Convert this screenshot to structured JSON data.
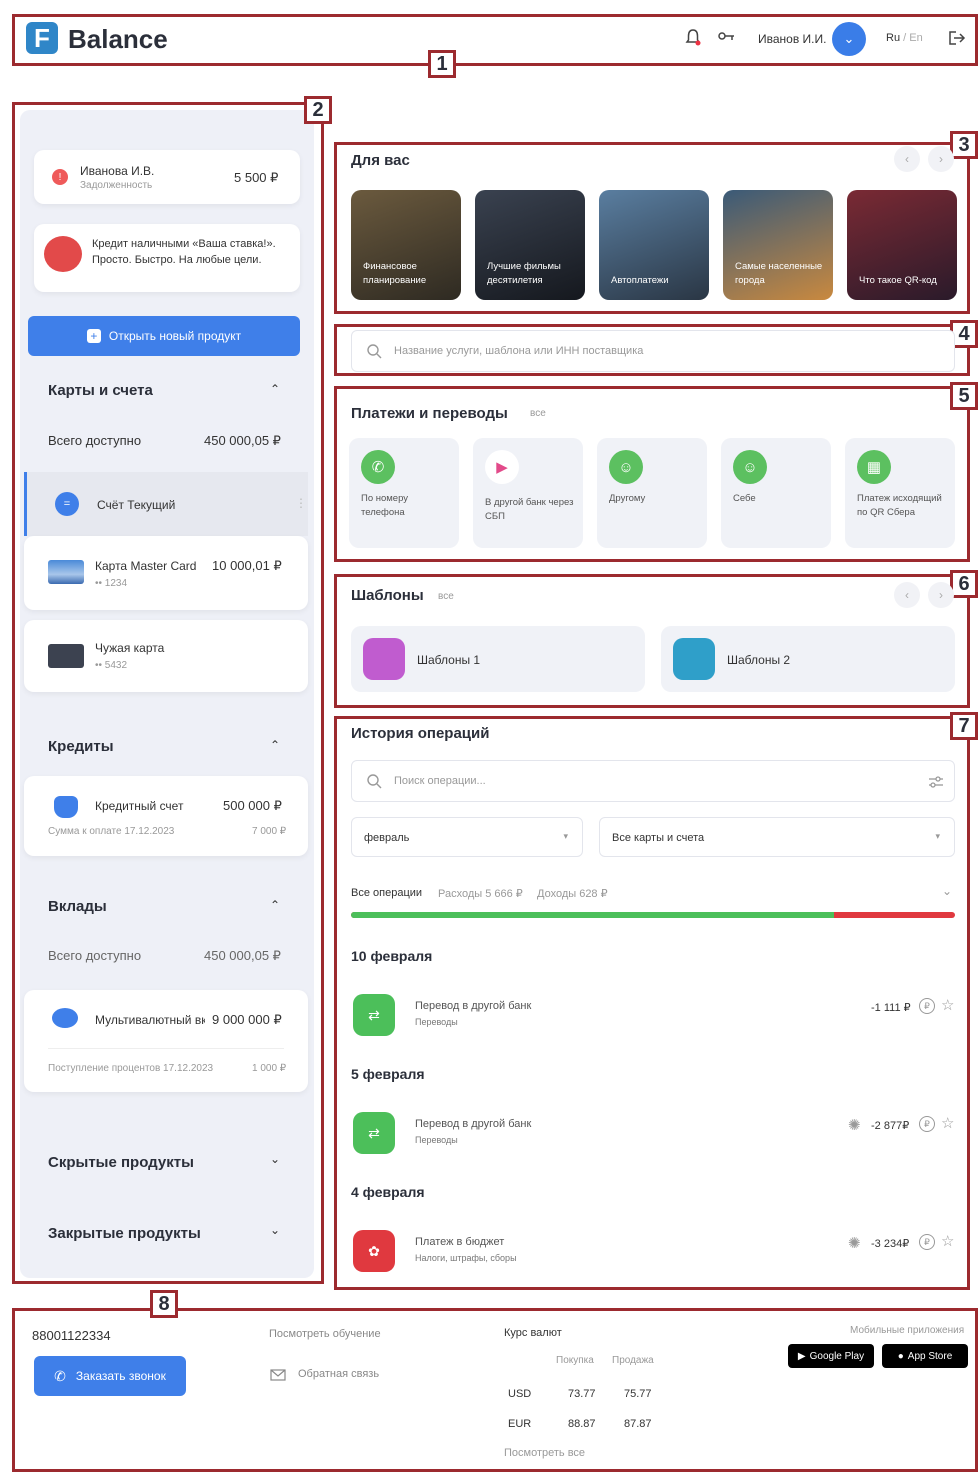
{
  "header": {
    "logo_letter": "F",
    "brand": "Balance",
    "user_name": "Иванов И.И.",
    "lang_ru": "Ru",
    "lang_sep": " / ",
    "lang_en": "En"
  },
  "tags": [
    "1",
    "2",
    "3",
    "4",
    "5",
    "6",
    "7",
    "8"
  ],
  "sidebar": {
    "debt": {
      "name": "Иванова И.В.",
      "sub": "Задолженность",
      "amount": "5 500 ₽"
    },
    "promo": {
      "text": "Кредит наличными «Ваша ставка!». Просто. Быстро. На любые цели."
    },
    "open_product": "Открыть новый продукт",
    "cards_section": {
      "title": "Карты и счета",
      "total_label": "Всего доступно",
      "total_value": "450 000,05 ₽",
      "items": [
        {
          "name": "Счёт Текущий",
          "amount": "",
          "sub": ""
        },
        {
          "name": "Карта Master Card",
          "amount": "10 000,01 ₽",
          "sub": "•• 1234"
        },
        {
          "name": "Чужая карта",
          "amount": "",
          "sub": "•• 5432"
        }
      ]
    },
    "credits_section": {
      "title": "Кредиты",
      "item_name": "Кредитный счет",
      "item_amount": "500 000 ₽",
      "item_sub": "Сумма к оплате 17.12.2023",
      "item_sub_amount": "7 000 ₽"
    },
    "deposits_section": {
      "title": "Вклады",
      "total_label": "Всего доступно",
      "total_value": "450 000,05 ₽",
      "item_name": "Мультивалютный вк",
      "item_amount": "9 000 000 ₽",
      "item_sub": "Поступление процентов 17.12.2023",
      "item_sub_amount": "1 000 ₽"
    },
    "hidden_products": "Скрытые продукты",
    "closed_products": "Закрытые продукты"
  },
  "for_you": {
    "title": "Для вас",
    "stories": [
      {
        "label": "Финансовое планирование",
        "color1": "#6b5a3e",
        "color2": "#2e2a22"
      },
      {
        "label": "Лучшие фильмы десятилетия",
        "color1": "#3a4250",
        "color2": "#15181e"
      },
      {
        "label": "Автоплатежи",
        "color1": "#5a7ea0",
        "color2": "#2a3644"
      },
      {
        "label": "Самые населенные города",
        "color1": "#3a5a78",
        "color2": "#c9893f"
      },
      {
        "label": "Что такое QR-код",
        "color1": "#7a2a34",
        "color2": "#2a1a2a"
      }
    ]
  },
  "search": {
    "placeholder": "Название услуги, шаблона или ИНН поставщика"
  },
  "payments": {
    "title": "Платежи и переводы",
    "all": "все",
    "tiles": [
      {
        "label": "По номеру телефона",
        "icon": "phone-icon"
      },
      {
        "label": "В другой банк через СБП",
        "icon": "sbp-icon"
      },
      {
        "label": "Другому",
        "icon": "person-add-icon"
      },
      {
        "label": "Себе",
        "icon": "person-icon"
      },
      {
        "label": "Платеж исходящий по QR Сбера",
        "icon": "qr-icon"
      }
    ]
  },
  "templates": {
    "title": "Шаблоны",
    "all": "все",
    "items": [
      {
        "label": "Шаблоны 1",
        "color": "#c05ccf"
      },
      {
        "label": "Шаблоны 2",
        "color": "#2f9fc9"
      }
    ]
  },
  "history": {
    "title": "История операций",
    "search_placeholder": "Поиск операции...",
    "month": "февраль",
    "accounts": "Все карты и счета",
    "filter_all": "Все операции",
    "filter_expenses": "Расходы 5 666 ₽",
    "filter_income": "Доходы 628 ₽",
    "income_share": 0.8,
    "groups": [
      {
        "date": "10 февраля",
        "name": "Перевод в другой банк",
        "category": "Переводы",
        "amount": "-1 111 ₽",
        "color": "#4cbf5a"
      },
      {
        "date": "5 февраля",
        "name": "Перевод в другой банк",
        "category": "Переводы",
        "amount": "-2 877₽",
        "color": "#4cbf5a"
      },
      {
        "date": "4 февраля",
        "name": "Платеж в бюджет",
        "category": "Налоги, штрафы, сборы",
        "amount": "-3 234₽",
        "color": "#e0393f"
      }
    ]
  },
  "footer": {
    "phone": "88001122334",
    "call_button": "Заказать звонок",
    "tutorial": "Посмотреть обучение",
    "feedback": "Обратная связь",
    "rates_title": "Курс валют",
    "buy": "Покупка",
    "sell": "Продажа",
    "rates": [
      {
        "cur": "USD",
        "buy": "73.77",
        "sell": "75.77"
      },
      {
        "cur": "EUR",
        "buy": "88.87",
        "sell": "87.87"
      }
    ],
    "see_all": "Посмотреть все",
    "mobile_apps": "Мобильные приложения",
    "google_play": "Google Play",
    "app_store": "App Store"
  },
  "colors": {
    "accent": "#3f7fe9",
    "frame": "#9c2a2f",
    "income": "#4cbf5a",
    "expense": "#e0393f"
  }
}
